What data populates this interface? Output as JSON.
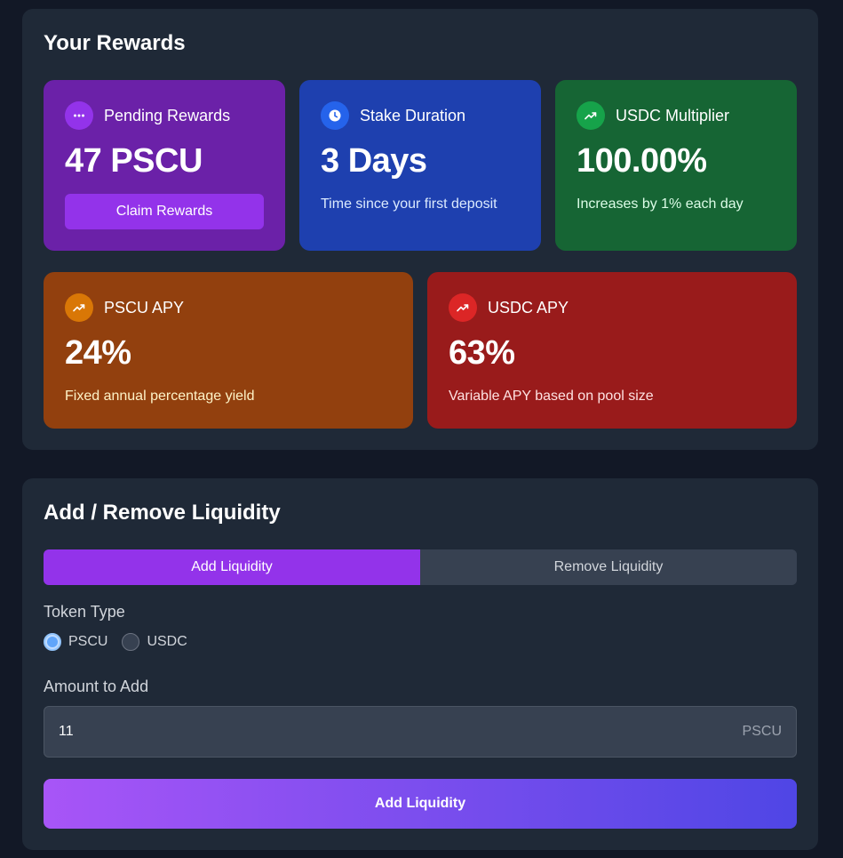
{
  "rewards": {
    "title": "Your Rewards",
    "pending": {
      "label": "Pending Rewards",
      "value": "47 PSCU",
      "button": "Claim Rewards",
      "icon": "dots-icon",
      "color": "#6b21a8"
    },
    "stake": {
      "label": "Stake Duration",
      "value": "3 Days",
      "sub": "Time since your first deposit",
      "icon": "clock-icon",
      "color": "#1e40af"
    },
    "multiplier": {
      "label": "USDC Multiplier",
      "value": "100.00%",
      "sub": "Increases by 1% each day",
      "icon": "trending-up-icon",
      "color": "#166534"
    },
    "pscu_apy": {
      "label": "PSCU APY",
      "value": "24%",
      "sub": "Fixed annual percentage yield",
      "icon": "trending-up-icon",
      "color": "#92400e"
    },
    "usdc_apy": {
      "label": "USDC APY",
      "value": "63%",
      "sub": "Variable APY based on pool size",
      "icon": "trending-up-icon",
      "color": "#991b1b"
    }
  },
  "liquidity": {
    "title": "Add / Remove Liquidity",
    "tabs": [
      {
        "label": "Add Liquidity",
        "active": true
      },
      {
        "label": "Remove Liquidity",
        "active": false
      }
    ],
    "token_type_label": "Token Type",
    "token_options": [
      {
        "label": "PSCU",
        "checked": true
      },
      {
        "label": "USDC",
        "checked": false
      }
    ],
    "amount_label": "Amount to Add",
    "amount_value": "11",
    "amount_unit": "PSCU",
    "submit": "Add Liquidity"
  }
}
